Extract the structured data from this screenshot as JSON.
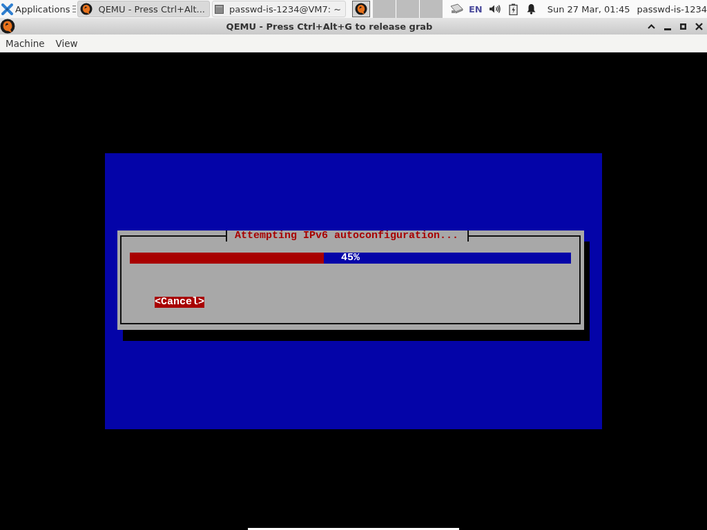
{
  "top_panel": {
    "applications": {
      "label": "Applications"
    },
    "tasks": [
      {
        "kind": "app",
        "label": "QEMU - Press Ctrl+Alt...",
        "selected": true
      },
      {
        "kind": "terminal",
        "label": "passwd-is-1234@VM7: ~",
        "selected": false
      },
      {
        "kind": "app",
        "selected": true
      }
    ],
    "tray": {
      "keyboard_layout": "EN",
      "clock": "Sun 27 Mar, 01:45",
      "user": "passwd-is-1234"
    }
  },
  "window": {
    "title": "QEMU - Press Ctrl+Alt+G to release grab"
  },
  "menu_bar": {
    "items": [
      "Machine",
      "View"
    ]
  },
  "guest_screen": {
    "dialog": {
      "title": "Attempting IPv6 autoconfiguration...",
      "progress": {
        "level": 0.44,
        "reading": "45%"
      },
      "buttons": [
        {
          "label": "<Cancel>",
          "focused": true
        }
      ]
    }
  }
}
